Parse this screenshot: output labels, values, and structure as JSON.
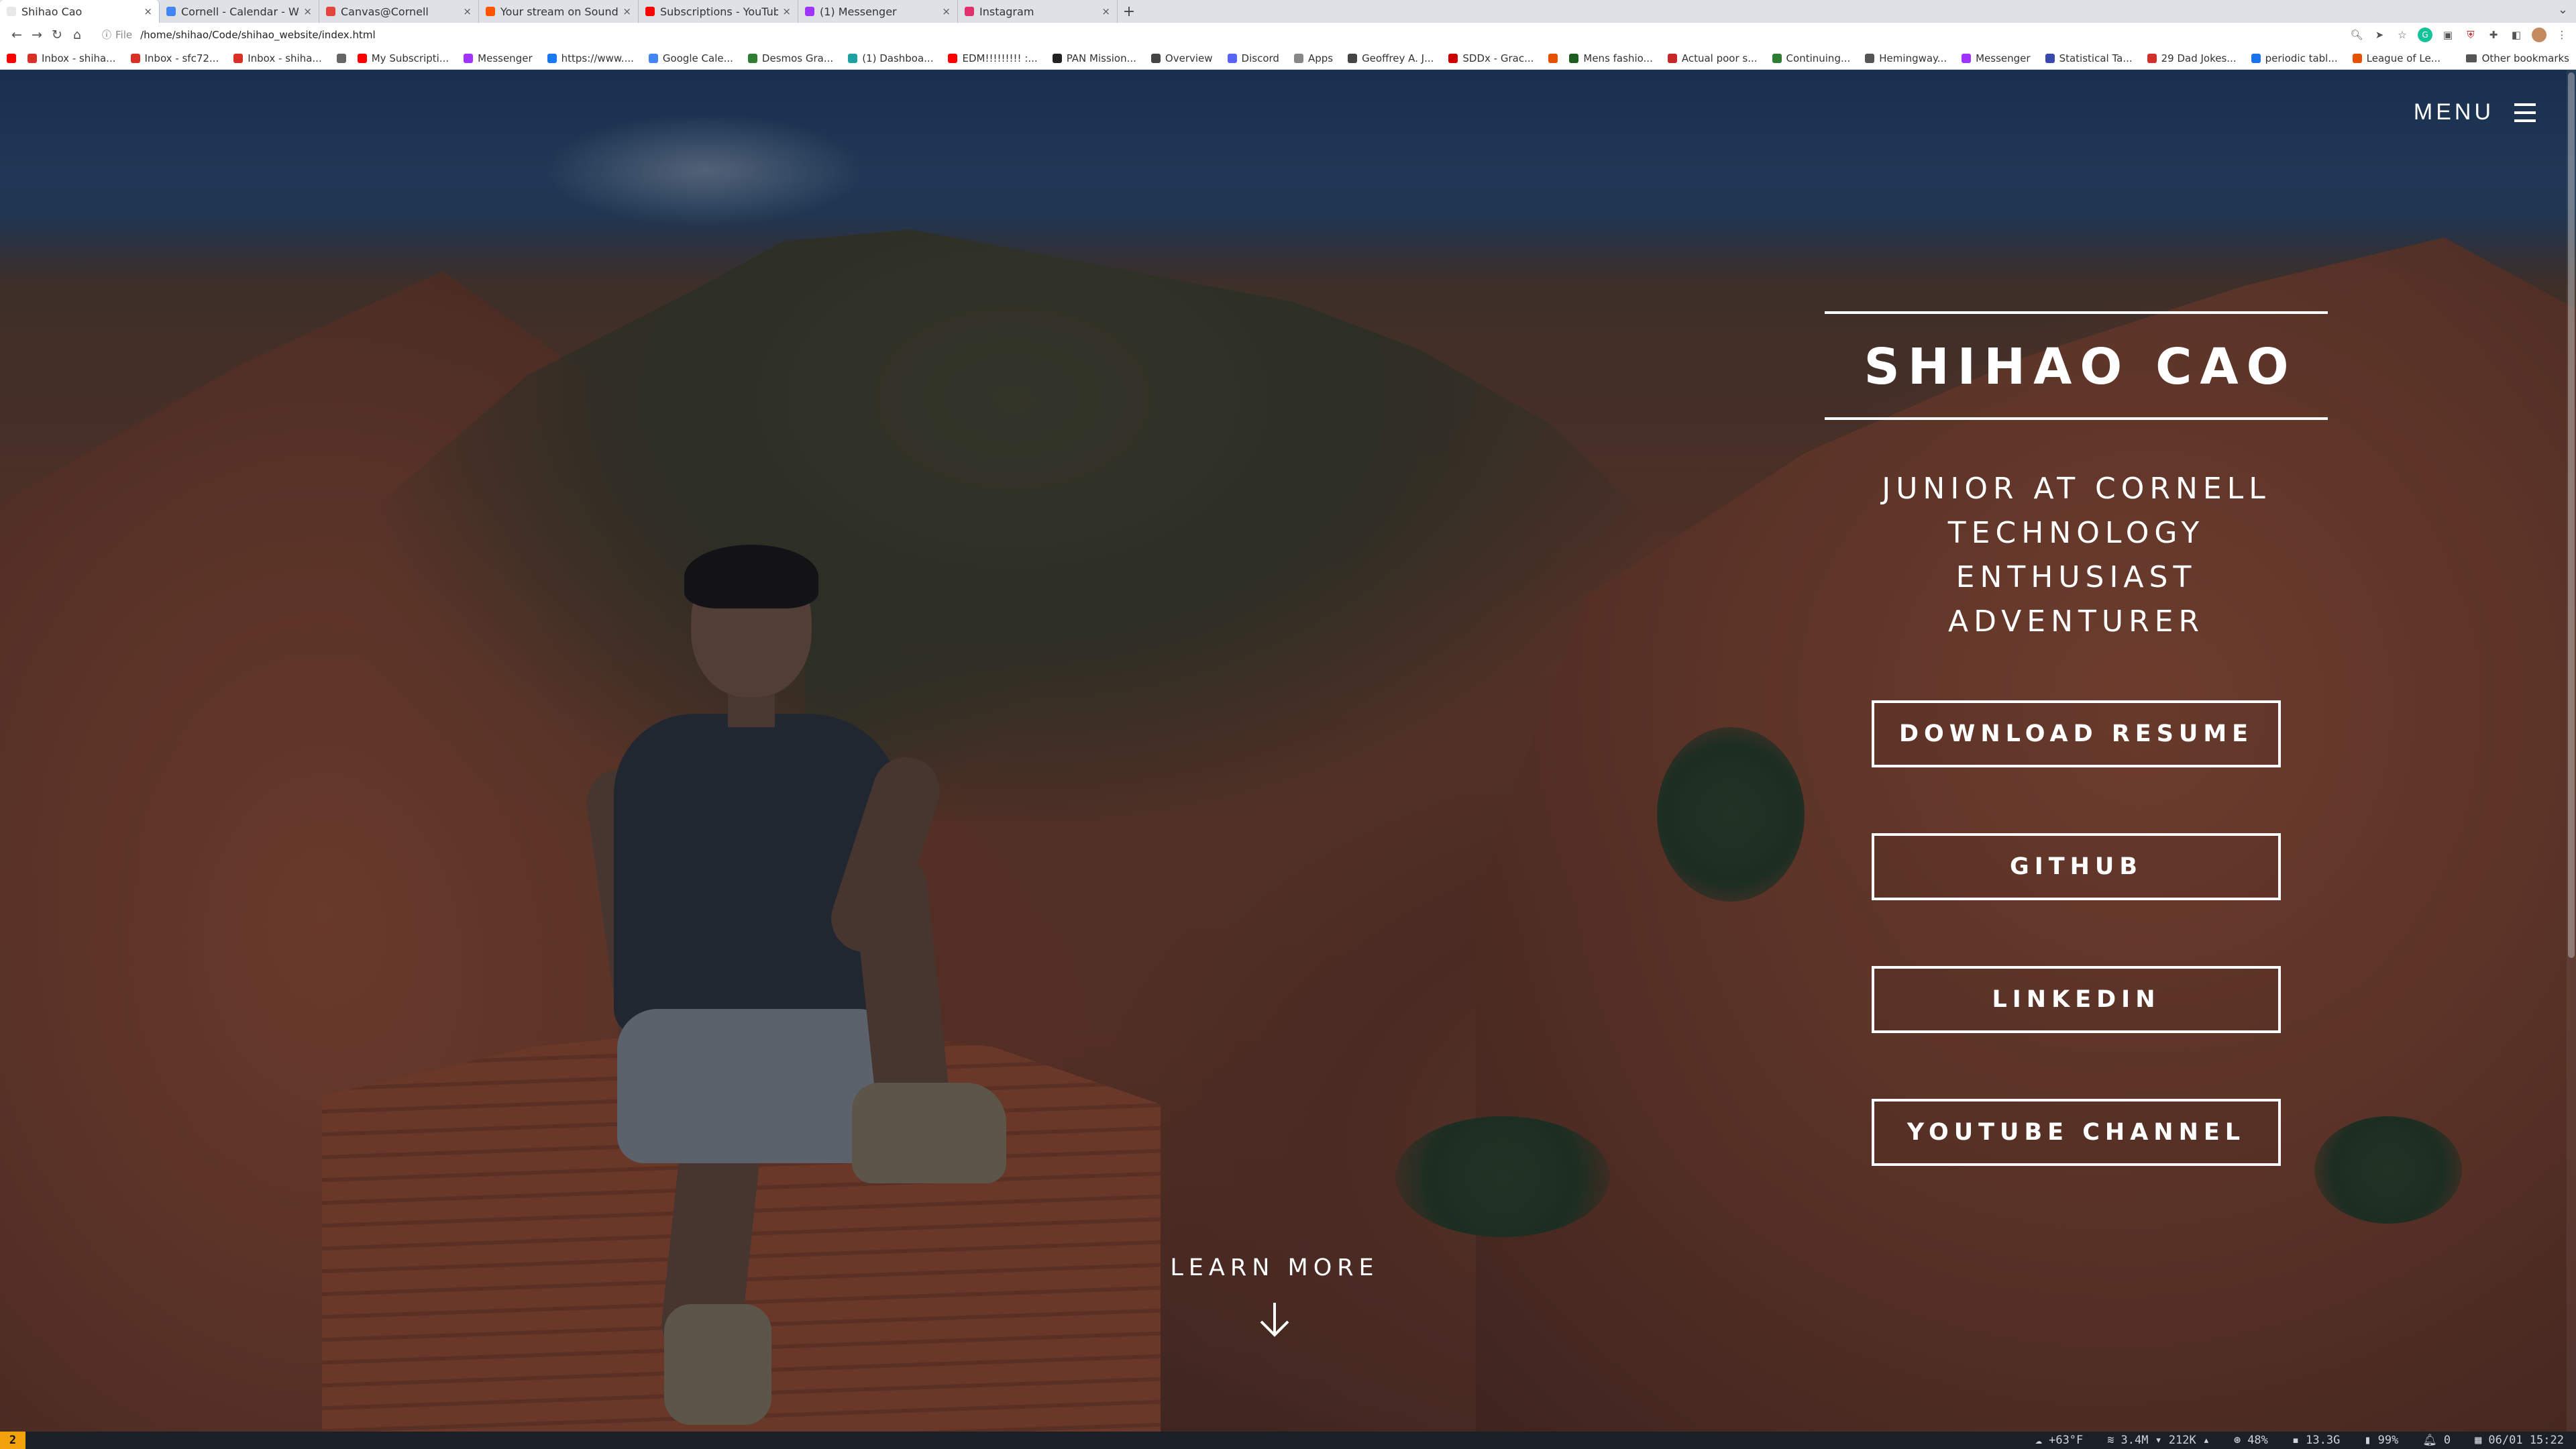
{
  "browser": {
    "tabs": [
      {
        "title": "Shihao Cao",
        "active": true,
        "color": "#e8e8e8"
      },
      {
        "title": "Cornell - Calendar - We",
        "active": false,
        "color": "#4285f4"
      },
      {
        "title": "Canvas@Cornell",
        "active": false,
        "color": "#e2453c"
      },
      {
        "title": "Your stream on Sound",
        "active": false,
        "color": "#ff5500"
      },
      {
        "title": "Subscriptions - YouTub",
        "active": false,
        "color": "#ff0000"
      },
      {
        "title": "(1) Messenger",
        "active": false,
        "color": "#a033ff"
      },
      {
        "title": "Instagram",
        "active": false,
        "color": "#e1306c"
      }
    ],
    "address": {
      "scheme": "File",
      "url": "/home/shihao/Code/shihao_website/index.html"
    },
    "bookmarks": [
      {
        "label": "",
        "color": "#ff0000"
      },
      {
        "label": "Inbox - shiha...",
        "color": "#d93025"
      },
      {
        "label": "Inbox - sfc72...",
        "color": "#d93025"
      },
      {
        "label": "Inbox - shiha...",
        "color": "#d93025"
      },
      {
        "label": "",
        "color": "#666666"
      },
      {
        "label": "My Subscripti...",
        "color": "#ff0000"
      },
      {
        "label": "Messenger",
        "color": "#a033ff"
      },
      {
        "label": "https://www....",
        "color": "#1877f2"
      },
      {
        "label": "Google Cale...",
        "color": "#4285f4"
      },
      {
        "label": "Desmos Gra...",
        "color": "#2f7d32"
      },
      {
        "label": "(1) Dashboa...",
        "color": "#1da1a1"
      },
      {
        "label": "EDM!!!!!!!!! :...",
        "color": "#ff0000"
      },
      {
        "label": "PAN Mission...",
        "color": "#222222"
      },
      {
        "label": "Overview",
        "color": "#444444"
      },
      {
        "label": "Discord",
        "color": "#5865f2"
      },
      {
        "label": "Apps",
        "color": "#888888"
      },
      {
        "label": "Geoffrey A. J...",
        "color": "#444444"
      },
      {
        "label": "SDDx - Grac...",
        "color": "#cc0000"
      },
      {
        "label": "",
        "color": "#e65100"
      },
      {
        "label": "Mens fashio...",
        "color": "#1b5e20"
      },
      {
        "label": "Actual poor s...",
        "color": "#c62828"
      },
      {
        "label": "Continuing...",
        "color": "#2e7d32"
      },
      {
        "label": "Hemingway...",
        "color": "#555555"
      },
      {
        "label": "Messenger",
        "color": "#a033ff"
      },
      {
        "label": "Statistical Ta...",
        "color": "#3949ab"
      },
      {
        "label": "29 Dad Jokes...",
        "color": "#d32f2f"
      },
      {
        "label": "periodic tabl...",
        "color": "#1a73e8"
      },
      {
        "label": "League of Le...",
        "color": "#e65100"
      }
    ],
    "other_bookmarks": "Other bookmarks"
  },
  "site": {
    "menu_label": "MENU",
    "name": "SHIHAO CAO",
    "taglines": [
      "JUNIOR AT CORNELL",
      "TECHNOLOGY ENTHUSIAST",
      "ADVENTURER"
    ],
    "actions": [
      {
        "label": "DOWNLOAD RESUME"
      },
      {
        "label": "GITHUB"
      },
      {
        "label": "LINKEDIN"
      },
      {
        "label": "YOUTUBE CHANNEL"
      }
    ],
    "learn_more": "LEARN MORE"
  },
  "statusbar": {
    "workspace": "2",
    "weather": "+63°F",
    "network_down": "3.4M",
    "network_up": "212K",
    "cpu": "48%",
    "memory": "13.3G",
    "battery": "99%",
    "notifications": "0",
    "datetime": "06/01 15:22"
  },
  "colors": {
    "accent": "#f2a30c",
    "sky": "#1f3c66",
    "rock": "#8a4128"
  }
}
